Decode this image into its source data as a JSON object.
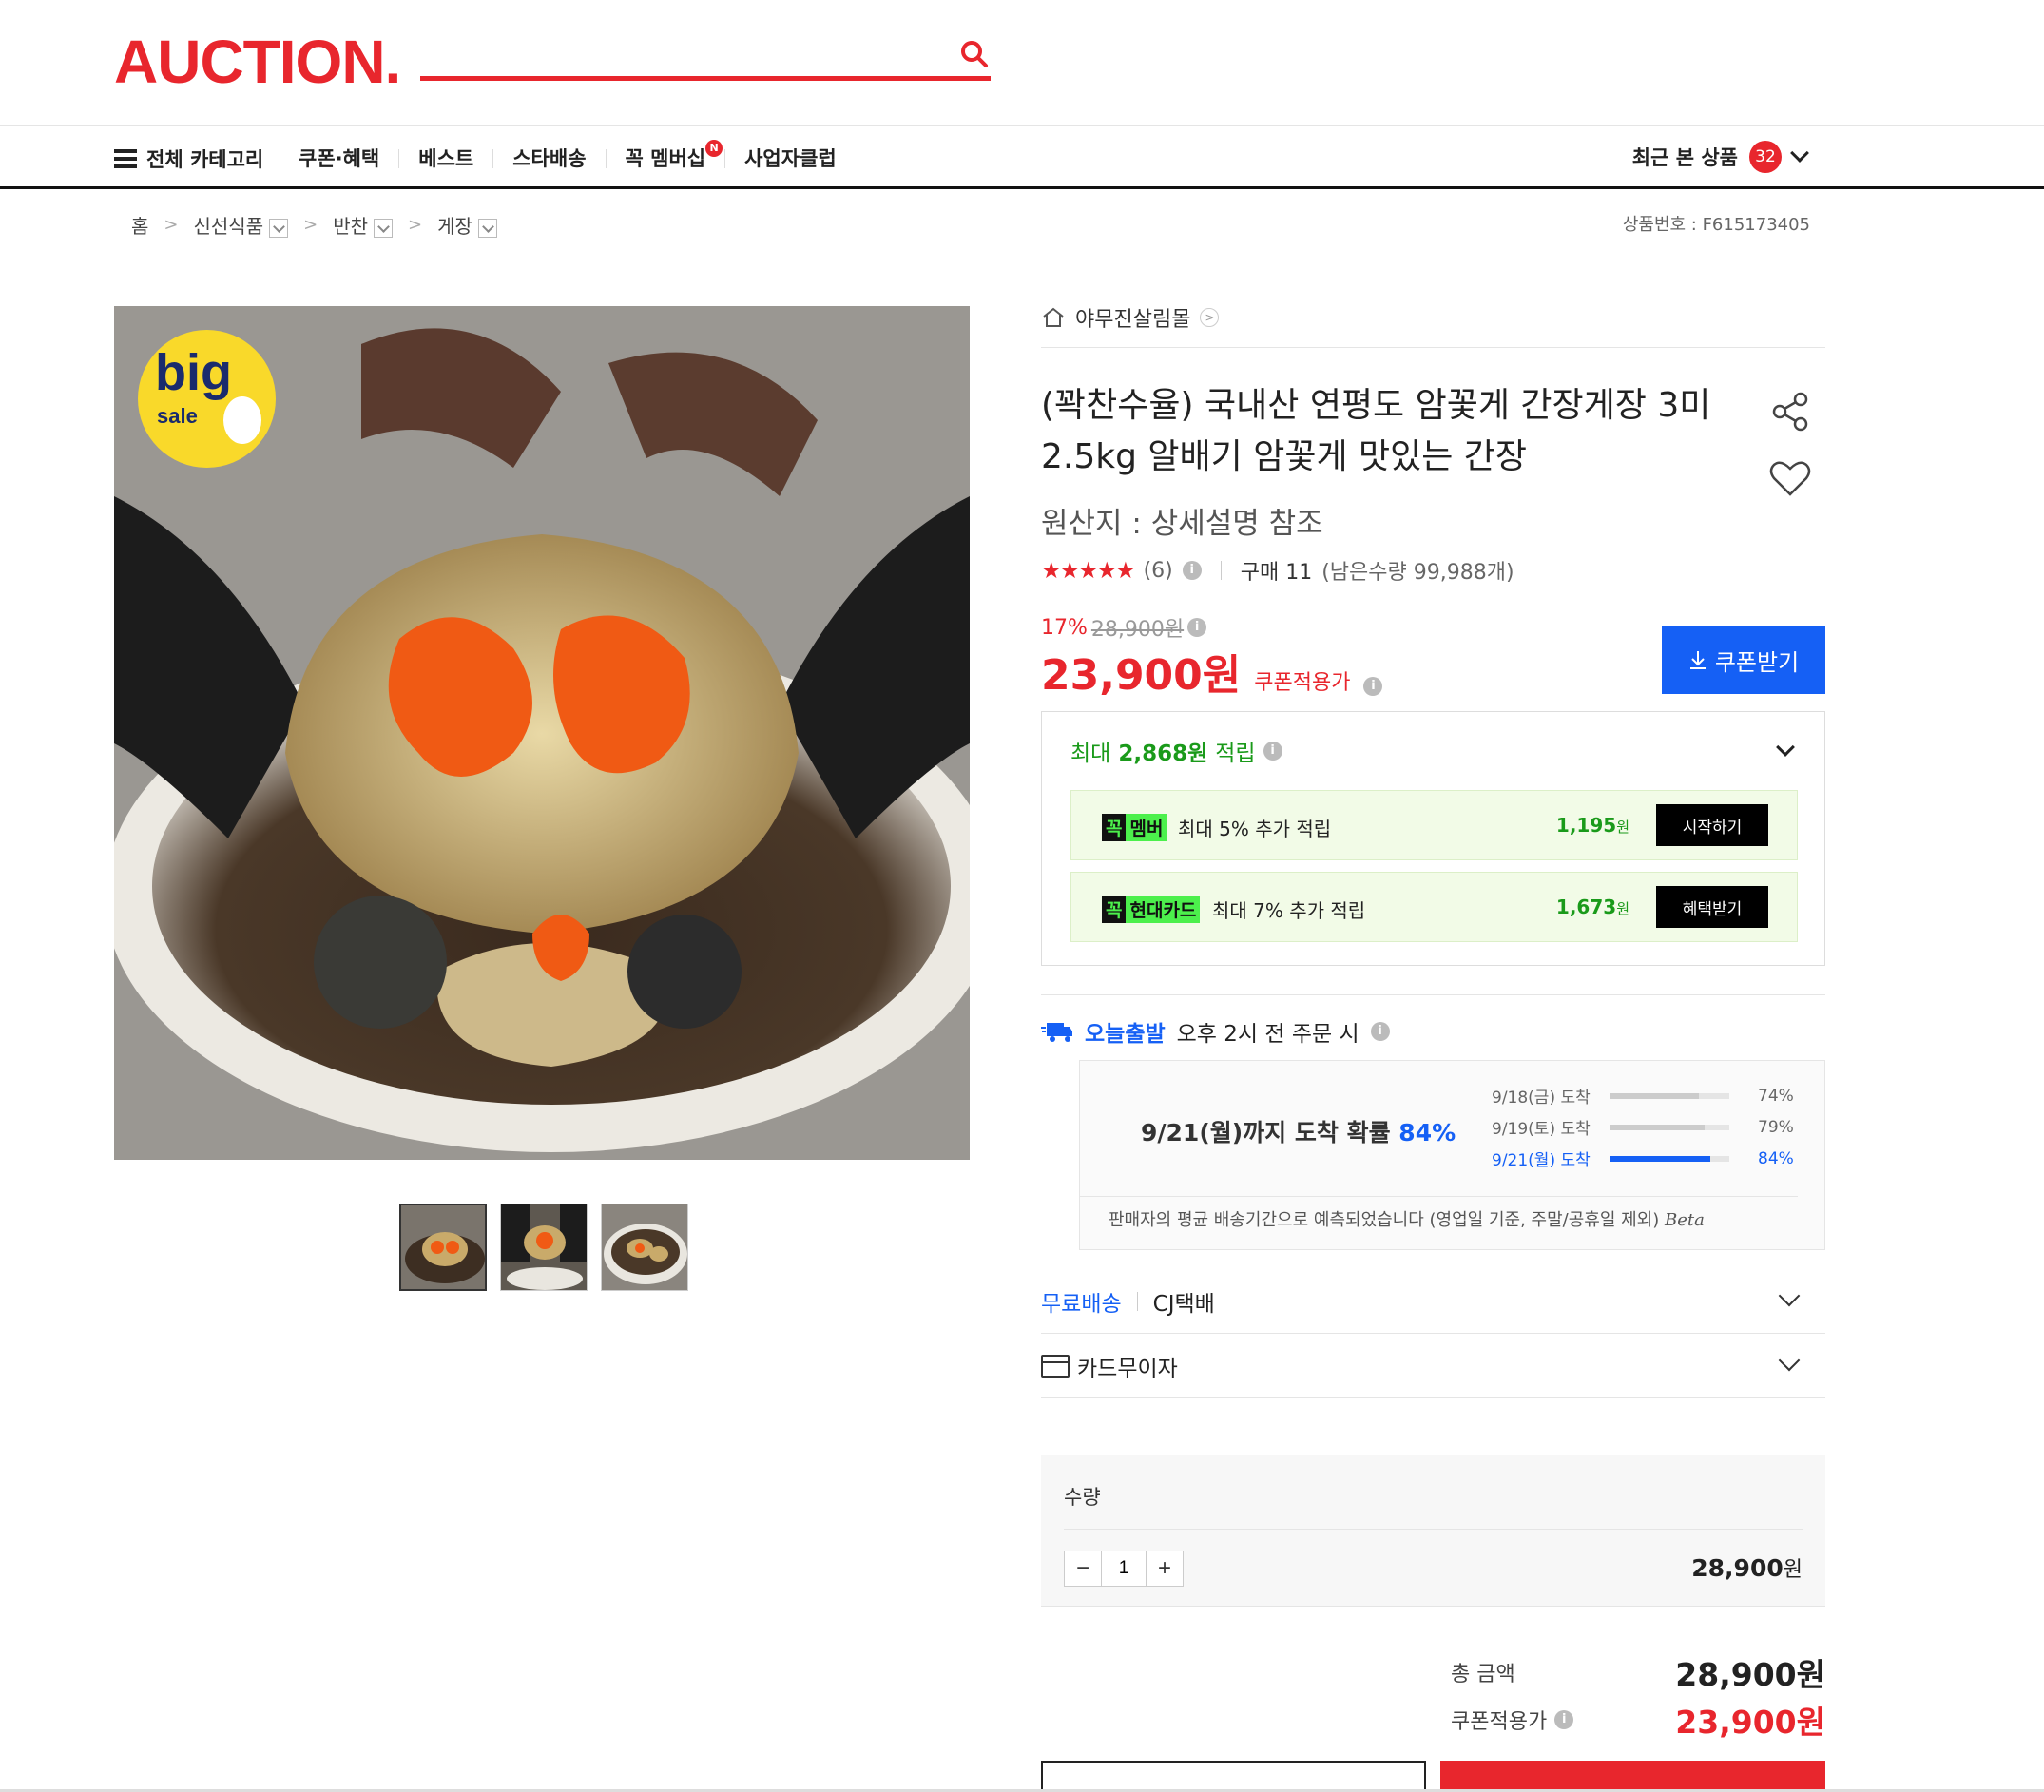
{
  "header": {
    "logo": "AUCTION.",
    "search_value": "",
    "search_placeholder": ""
  },
  "nav": {
    "all_categories": "전체 카테고리",
    "items": [
      "쿠폰·혜택",
      "베스트",
      "스타배송",
      "꼭 멤버십",
      "사업자클럽"
    ],
    "membership_badge": "N",
    "recent_label": "최근 본 상품",
    "recent_count": "32"
  },
  "breadcrumb": {
    "home": "홈",
    "items": [
      "신선식품",
      "반찬",
      "게장"
    ],
    "product_no": "상품번호 : F615173405"
  },
  "product": {
    "store": "야무진살림몰",
    "title": "(꽉찬수율) 국내산 연평도 암꽃게 간장게장 3미 2.5kg 알배기 암꽃게 맛있는 간장",
    "origin": "원산지 : 상세설명 참조",
    "stars": "★★★★★",
    "review_count": "(6)",
    "purchase_label": "구매 11",
    "remaining": "(남은수량 99,988개)",
    "discount_pct": "17%",
    "original_price": "28,900원",
    "coupon_price": "23,900원",
    "coupon_price_label": "쿠폰적용가",
    "coupon_button": "쿠폰받기",
    "image_badge_big": "big",
    "image_badge_sale": "sale"
  },
  "points": {
    "label_prefix": "최대",
    "amount": "2,868원",
    "label_suffix": "적립",
    "rows": [
      {
        "tag_k": "꼭",
        "tag_t": "멤버",
        "desc": "최대 5% 추가 적립",
        "amount": "1,195",
        "unit": "원",
        "action": "시작하기"
      },
      {
        "tag_k": "꼭",
        "tag_t": "현대카드",
        "desc": "최대 7% 추가 적립",
        "amount": "1,673",
        "unit": "원",
        "action": "혜택받기"
      }
    ]
  },
  "shipping": {
    "today_label": "오늘출발",
    "cutoff": "오후 2시 전 주문 시",
    "main_text": "9/21(월)까지 도착 확률",
    "main_pct": "84%",
    "rows": [
      {
        "date": "9/18(금) 도착",
        "pct": "74%",
        "value": 0.74,
        "highlight": false
      },
      {
        "date": "9/19(토) 도착",
        "pct": "79%",
        "value": 0.79,
        "highlight": false
      },
      {
        "date": "9/21(월) 도착",
        "pct": "84%",
        "value": 0.84,
        "highlight": true
      }
    ],
    "note": "판매자의 평균 배송기간으로 예측되었습니다 (영업일 기준, 주말/공휴일 제외)",
    "beta": "Beta",
    "free_shipping": "무료배송",
    "courier": "CJ택배",
    "card_label": "카드무이자"
  },
  "quantity": {
    "label": "수량",
    "value": "1",
    "price": "28,900",
    "unit": "원"
  },
  "total": {
    "total_label": "총 금액",
    "total_value": "28,900원",
    "coupon_label": "쿠폰적용가",
    "coupon_value": "23,900원"
  },
  "colors": {
    "brand_red": "#e8262d",
    "blue": "#1560f5",
    "green": "#1a9a1a"
  }
}
